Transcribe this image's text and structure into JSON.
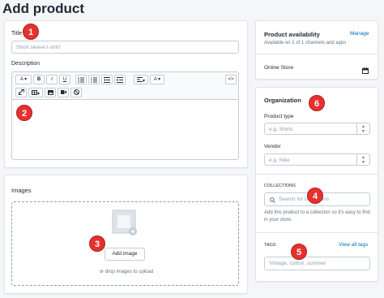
{
  "page": {
    "title": "Add product"
  },
  "product": {
    "title_label": "Title",
    "title_placeholder": "Short sleeve t-shirt",
    "description_label": "Description",
    "toolbar": {
      "paragraph": "A",
      "bold": "B",
      "italic": "I",
      "underline": "U",
      "text_color": "A",
      "html": "<>"
    }
  },
  "images": {
    "title": "Images",
    "add_button": "Add image",
    "drop_hint": "or drop images to upload"
  },
  "availability": {
    "title": "Product availability",
    "manage_link": "Manage",
    "subtitle": "Available on 1 of 1 channels and apps",
    "channel": "Online Store"
  },
  "organization": {
    "title": "Organization",
    "product_type_label": "Product type",
    "product_type_placeholder": "e.g. Shirts",
    "vendor_label": "Vendor",
    "vendor_placeholder": "e.g. Nike",
    "collections_label": "COLLECTIONS",
    "collections_placeholder": "Search for collections",
    "collections_hint": "Add this product to a collection so it's easy to find in your store.",
    "tags_label": "TAGS",
    "tags_link": "View all tags",
    "tags_placeholder": "Vintage, cotton, summer"
  },
  "badges": [
    "1",
    "2",
    "3",
    "4",
    "5",
    "6"
  ],
  "colors": {
    "accent": "#006fbb",
    "badge": "#e5322d",
    "background": "#f4f6f8"
  },
  "icons": [
    "chevron-down-icon",
    "list-icon",
    "indent-icon",
    "link-icon",
    "table-icon",
    "image-icon",
    "video-icon",
    "clear-format-icon",
    "code-icon",
    "calendar-icon",
    "search-icon",
    "image-placeholder-icon"
  ]
}
